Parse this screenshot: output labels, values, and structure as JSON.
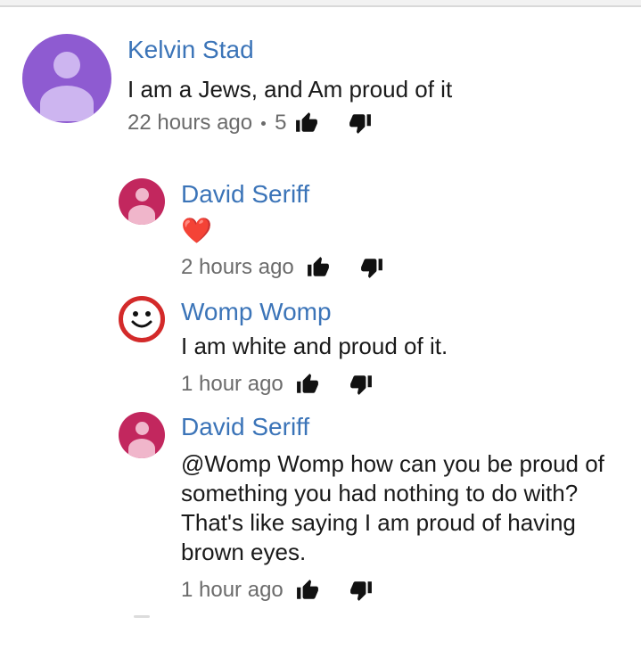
{
  "comments": [
    {
      "author": "Kelvin Stad",
      "text": "I am a Jews, and Am proud of it",
      "time": "22 hours ago",
      "likes": "5",
      "avatar_color": "#8e5bd1"
    }
  ],
  "replies": [
    {
      "author": "David Seriff",
      "text": "❤️",
      "time": "2 hours ago",
      "avatar_color": "#c2275e"
    },
    {
      "author": "Womp Womp",
      "text": "I am white and proud of it.",
      "time": "1 hour ago",
      "avatar_color": "#d32a2a"
    },
    {
      "author": "David Seriff",
      "text": "@Womp Womp how can you be proud of something you had nothing to do with? That's like saying I am proud of having brown eyes.",
      "time": "1 hour ago",
      "avatar_color": "#c2275e"
    }
  ],
  "icons": {
    "like": "thumbs-up-icon",
    "dislike": "thumbs-down-icon"
  },
  "colors": {
    "author_link": "#3b74b8",
    "meta_text": "#6b6b6b"
  }
}
